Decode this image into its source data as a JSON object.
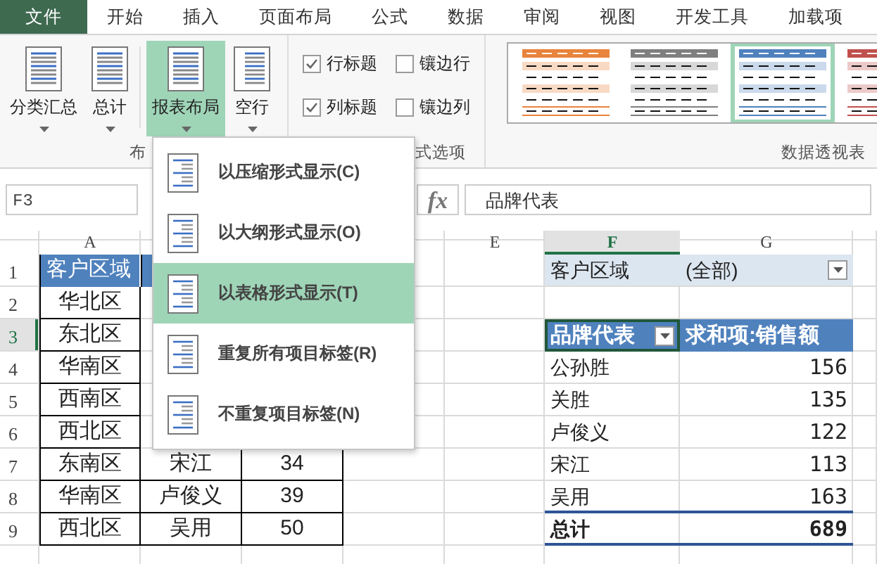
{
  "tabs": [
    {
      "label": "文件",
      "selected": true
    },
    {
      "label": "开始",
      "selected": false
    },
    {
      "label": "插入",
      "selected": false
    },
    {
      "label": "页面布局",
      "selected": false
    },
    {
      "label": "公式",
      "selected": false
    },
    {
      "label": "数据",
      "selected": false
    },
    {
      "label": "审阅",
      "selected": false
    },
    {
      "label": "视图",
      "selected": false
    },
    {
      "label": "开发工具",
      "selected": false
    },
    {
      "label": "加载项",
      "selected": false
    }
  ],
  "ribbon": {
    "layout_buttons": [
      {
        "label": "分类汇总",
        "expanded": false
      },
      {
        "label": "总计",
        "expanded": false
      },
      {
        "label": "报表布局",
        "expanded": true
      },
      {
        "label": "空行",
        "expanded": false
      }
    ],
    "layout_group_label": "布",
    "options": [
      {
        "label": "行标题",
        "checked": true
      },
      {
        "label": "镶边行",
        "checked": false
      },
      {
        "label": "列标题",
        "checked": true
      },
      {
        "label": "镶边列",
        "checked": false
      }
    ],
    "options_group_label": "式选项",
    "styles": [
      {
        "color": "#e8843c",
        "selected": false
      },
      {
        "color": "#7f7f7f",
        "selected": false
      },
      {
        "color": "#4f81bd",
        "selected": true
      },
      {
        "color": "#c0504d",
        "selected": false
      }
    ],
    "styles_group_label": "数据透视表"
  },
  "formula_bar": {
    "name_box": "F3",
    "fx": "fx",
    "value": "品牌代表"
  },
  "columns": [
    "A",
    "E",
    "F",
    "G"
  ],
  "row_numbers": [
    "1",
    "2",
    "3",
    "4",
    "5",
    "6",
    "7",
    "8",
    "9"
  ],
  "source_table": {
    "header": "客户区域",
    "rows": [
      {
        "region": "华北区"
      },
      {
        "region": "东北区"
      },
      {
        "region": "华南区"
      },
      {
        "region": "西南区"
      },
      {
        "region": "西北区"
      },
      {
        "region": "东南区",
        "name": "宋江",
        "amount": "34"
      },
      {
        "region": "华南区",
        "name": "卢俊义",
        "amount": "39"
      },
      {
        "region": "西北区",
        "name": "吴用",
        "amount": "50"
      }
    ]
  },
  "pivot": {
    "filter_label": "客户区域",
    "filter_value": "(全部)",
    "row_header": "品牌代表",
    "value_header": "求和项:销售额",
    "rows": [
      {
        "label": "公孙胜",
        "value": "156"
      },
      {
        "label": "关胜",
        "value": "135"
      },
      {
        "label": "卢俊义",
        "value": "122"
      },
      {
        "label": "宋江",
        "value": "113"
      },
      {
        "label": "吴用",
        "value": "163"
      }
    ],
    "total_label": "总计",
    "total_value": "689"
  },
  "menu": {
    "items": [
      {
        "label": "以压缩形式显示(C)",
        "selected": false
      },
      {
        "label": "以大纲形式显示(O)",
        "selected": false
      },
      {
        "label": "以表格形式显示(T)",
        "selected": true
      },
      {
        "label": "重复所有项目标签(R)",
        "selected": false
      },
      {
        "label": "不重复项目标签(N)",
        "selected": false
      }
    ]
  }
}
